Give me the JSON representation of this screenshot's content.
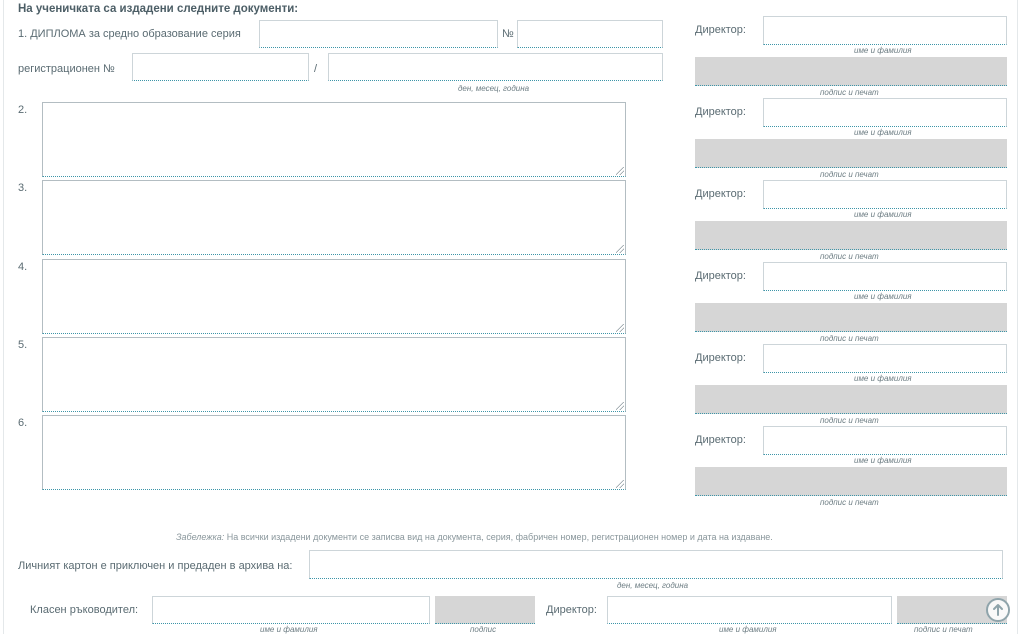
{
  "form": {
    "heading": "На ученичката са издадени следните документи:",
    "diploma": {
      "label": "1. ДИПЛОМА за средно образование серия",
      "number_label": "№",
      "reg_label": "регистрационен №",
      "slash": "/",
      "date_hint": "ден, месец, година",
      "series_value": "",
      "number_value": "",
      "reg_value": "",
      "date_value": ""
    },
    "documents": [
      {
        "label": "2.",
        "value": ""
      },
      {
        "label": "3.",
        "value": ""
      },
      {
        "label": "4.",
        "value": ""
      },
      {
        "label": "5.",
        "value": ""
      },
      {
        "label": "6.",
        "value": ""
      }
    ],
    "director_blocks": [
      {
        "label": "Директор:",
        "name_hint": "име и фамилия",
        "sign_hint": "подпис и печат",
        "name_value": ""
      },
      {
        "label": "Директор:",
        "name_hint": "име и фамилия",
        "sign_hint": "подпис и печат",
        "name_value": ""
      },
      {
        "label": "Директор:",
        "name_hint": "име и фамилия",
        "sign_hint": "подпис и печат",
        "name_value": ""
      },
      {
        "label": "Директор:",
        "name_hint": "име и фамилия",
        "sign_hint": "подпис и печат",
        "name_value": ""
      },
      {
        "label": "Директор:",
        "name_hint": "име и фамилия",
        "sign_hint": "подпис и печат",
        "name_value": ""
      },
      {
        "label": "Директор:",
        "name_hint": "име и фамилия",
        "sign_hint": "подпис и печат",
        "name_value": ""
      }
    ],
    "note": {
      "prefix": "Забележка:",
      "text": " На всички издадени документи се записва вид на документа, серия, фабричен номер, регистрационен номер и дата на издаване."
    },
    "archive": {
      "label": "Личният картон е приключен и предаден в архива на:",
      "date_hint": "ден, месец, година",
      "value": ""
    },
    "footer": {
      "teacher_label": "Класен ръководител:",
      "teacher_name_hint": "име и фамилия",
      "teacher_sign_hint": "подпис",
      "director_label": "Директор:",
      "director_name_hint": "име и фамилия",
      "director_sign_hint": "подпис и печат",
      "teacher_value": "",
      "director_value": ""
    }
  },
  "icons": {
    "scroll_top": "arrow-up-circle-icon"
  },
  "colors": {
    "accent": "#3d95a8",
    "signature_box": "#d6d6d6",
    "text": "#5a6b72",
    "heading": "#4c5e66"
  }
}
